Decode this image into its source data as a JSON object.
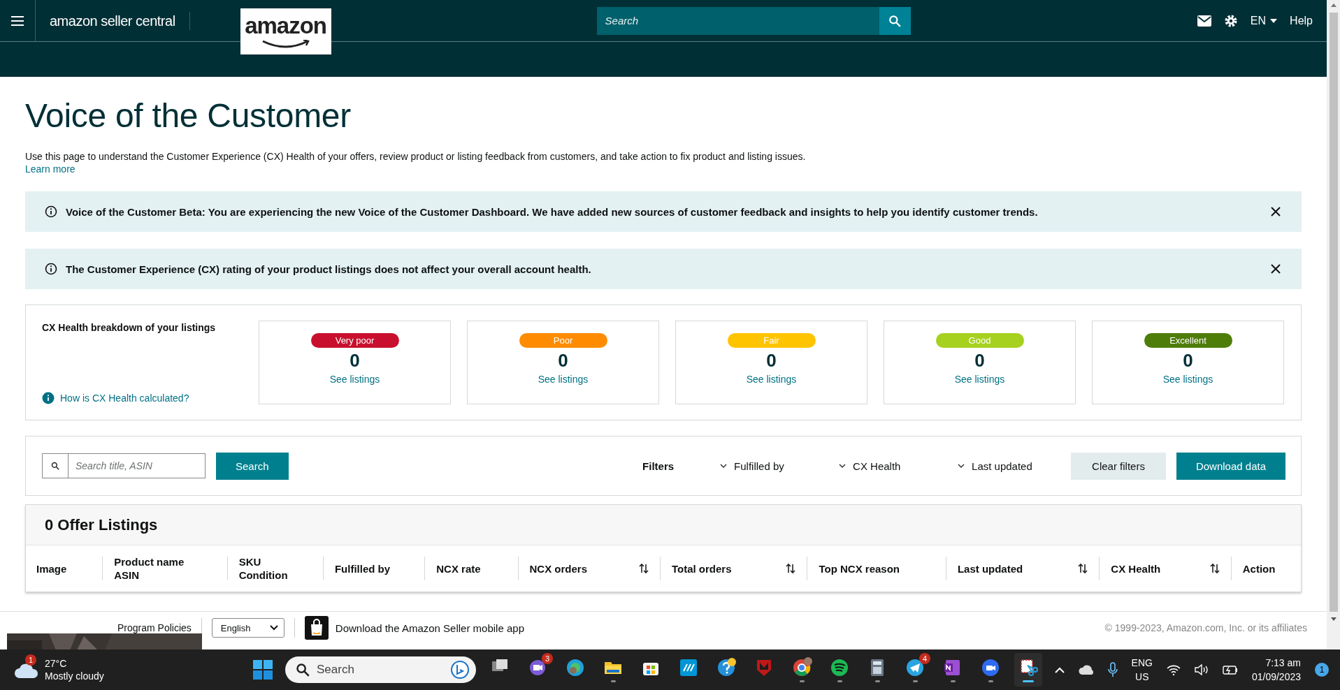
{
  "header": {
    "brand": "amazon seller central",
    "logo": "amazon",
    "search_placeholder": "Search",
    "language": "EN",
    "help": "Help"
  },
  "page": {
    "title": "Voice of the Customer",
    "description": "Use this page to understand the Customer Experience (CX) Health of your offers, review product or listing feedback from customers, and take action to fix product and listing issues.",
    "learn_more": "Learn more"
  },
  "banners": [
    {
      "text": "Voice of the Customer Beta: You are experiencing the new Voice of the Customer Dashboard. We have added new sources of customer feedback and insights to help you identify customer trends."
    },
    {
      "text": "The Customer Experience (CX) rating of your product listings does not affect your overall account health."
    }
  ],
  "cx_health": {
    "title": "CX Health breakdown of your listings",
    "help_link": "How is CX Health calculated?",
    "tiers": [
      {
        "label": "Very poor",
        "color": "#c8102e",
        "count": "0",
        "link": "See listings"
      },
      {
        "label": "Poor",
        "color": "#ff8c00",
        "count": "0",
        "link": "See listings"
      },
      {
        "label": "Fair",
        "color": "#ffc400",
        "count": "0",
        "link": "See listings"
      },
      {
        "label": "Good",
        "color": "#a6d11f",
        "count": "0",
        "link": "See listings"
      },
      {
        "label": "Excellent",
        "color": "#4e7d0a",
        "count": "0",
        "link": "See listings"
      }
    ]
  },
  "filters": {
    "search_placeholder": "Search title, ASIN",
    "search_button": "Search",
    "label": "Filters",
    "dropdowns": [
      "Fulfilled by",
      "CX Health",
      "Last updated"
    ],
    "clear_button": "Clear filters",
    "download_button": "Download data"
  },
  "table": {
    "title": "0 Offer Listings",
    "columns": [
      {
        "lines": [
          "Image"
        ],
        "sortable": false
      },
      {
        "lines": [
          "Product name",
          "ASIN"
        ],
        "sortable": false
      },
      {
        "lines": [
          "SKU",
          "Condition"
        ],
        "sortable": false
      },
      {
        "lines": [
          "Fulfilled by"
        ],
        "sortable": false
      },
      {
        "lines": [
          "NCX rate"
        ],
        "sortable": false
      },
      {
        "lines": [
          "NCX orders"
        ],
        "sortable": true
      },
      {
        "lines": [
          "Total orders"
        ],
        "sortable": true
      },
      {
        "lines": [
          "Top NCX reason"
        ],
        "sortable": false
      },
      {
        "lines": [
          "Last updated"
        ],
        "sortable": true
      },
      {
        "lines": [
          "CX Health"
        ],
        "sortable": true
      },
      {
        "lines": [
          "Action"
        ],
        "sortable": false
      }
    ]
  },
  "footer": {
    "links": [
      "Program Policies"
    ],
    "language": "English",
    "app_text": "Download the Amazon Seller mobile app",
    "copyright": "© 1999-2023, Amazon.com, Inc. or its affiliates"
  },
  "taskbar": {
    "weather": {
      "badge": "1",
      "temperature": "27°C",
      "condition": "Mostly cloudy"
    },
    "search_placeholder": "Search",
    "apps": [
      {
        "kind": "taskview",
        "running": false,
        "selected": false
      },
      {
        "kind": "meet",
        "badge": "3",
        "running": false,
        "selected": false
      },
      {
        "kind": "edge",
        "running": false,
        "selected": false
      },
      {
        "kind": "folder",
        "running": true,
        "selected": false
      },
      {
        "kind": "store",
        "running": false,
        "selected": false
      },
      {
        "kind": "hp",
        "running": false,
        "selected": false
      },
      {
        "kind": "help",
        "running": false,
        "selected": false
      },
      {
        "kind": "shield",
        "running": false,
        "selected": false
      },
      {
        "kind": "chrome",
        "running": true,
        "selected": false
      },
      {
        "kind": "spotify",
        "running": true,
        "selected": false
      },
      {
        "kind": "calculator",
        "running": true,
        "selected": false
      },
      {
        "kind": "telegram",
        "badge": "4",
        "running": true,
        "selected": false
      },
      {
        "kind": "onenote",
        "running": true,
        "selected": false
      },
      {
        "kind": "zoom",
        "running": true,
        "selected": false
      },
      {
        "kind": "snip",
        "running": true,
        "selected": true
      }
    ],
    "tray": {
      "language": "ENG",
      "region": "US",
      "time": "7:13 am",
      "date": "01/09/2023",
      "notifications": "1"
    }
  }
}
